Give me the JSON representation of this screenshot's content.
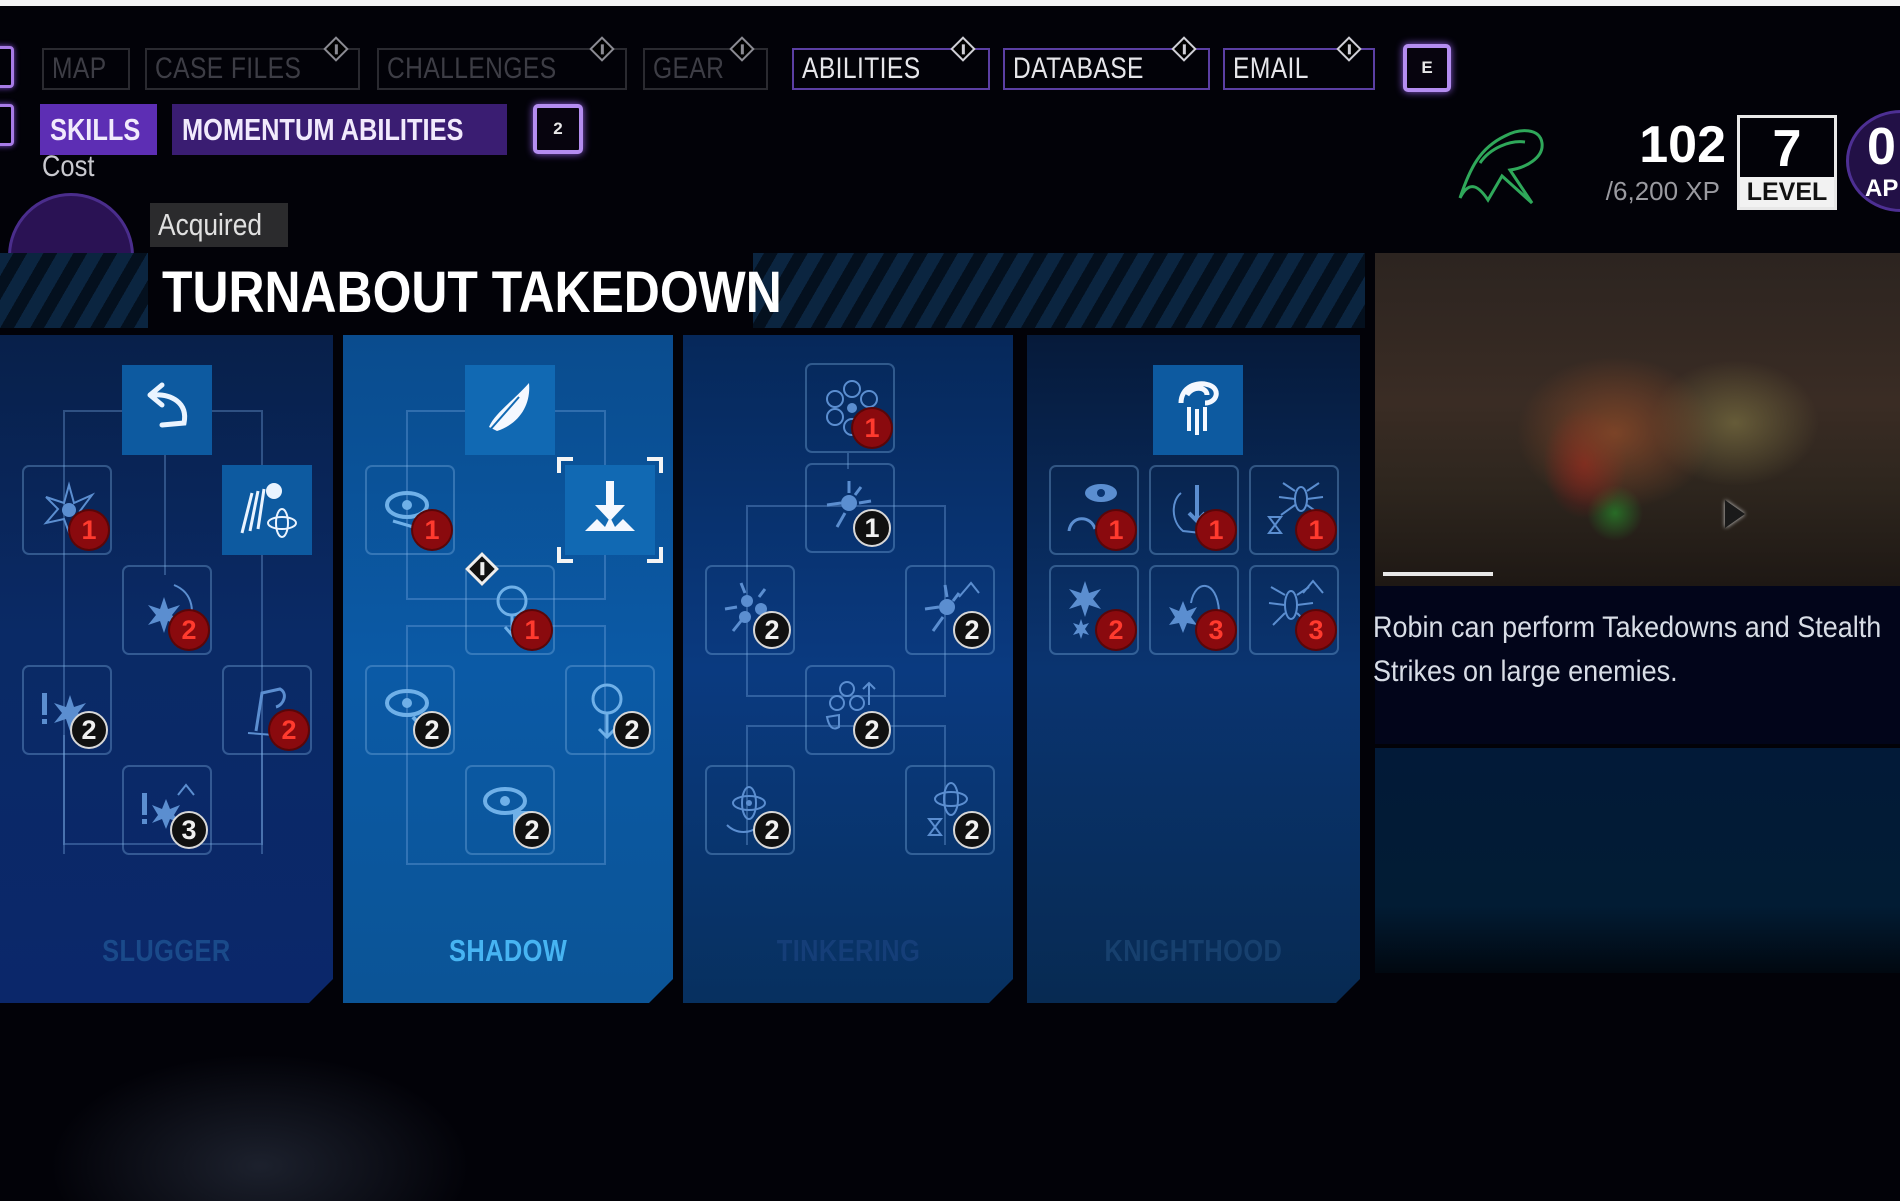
{
  "top_tabs": [
    {
      "label": "MAP",
      "active": false,
      "has_alert": false
    },
    {
      "label": "CASE FILES",
      "active": false,
      "has_alert": true
    },
    {
      "label": "CHALLENGES",
      "active": false,
      "has_alert": true
    },
    {
      "label": "GEAR",
      "active": false,
      "has_alert": true
    },
    {
      "label": "ABILITIES",
      "active": true,
      "has_alert": true
    },
    {
      "label": "DATABASE",
      "active": true,
      "has_alert": true
    },
    {
      "label": "EMAIL",
      "active": true,
      "has_alert": true
    }
  ],
  "top_next_key": "E",
  "sub_tabs": [
    {
      "label": "SKILLS",
      "active": true
    },
    {
      "label": "MOMENTUM ABILITIES",
      "active": false
    }
  ],
  "sub_next_key": "2",
  "ability": {
    "cost_label": "Cost",
    "cost_unit": "AP",
    "status": "Acquired",
    "title": "TURNABOUT TAKEDOWN",
    "description": "Robin can perform Takedowns and Stealth Strikes on large enemies.",
    "preview_icon": "video-preview"
  },
  "player": {
    "character_icon": "robin-r-logo",
    "xp_current": "102",
    "xp_total": "/6,200 XP",
    "level": "7",
    "level_label": "LEVEL",
    "ap_value": "0",
    "ap_label": "AP"
  },
  "trees": [
    {
      "name": "SLUGGER",
      "selected": false,
      "nodes": [
        {
          "icon": "curved-arrow-icon",
          "unlocked": true,
          "cost": null
        },
        {
          "icon": "impact-burst-icon",
          "unlocked": false,
          "cost": "1",
          "affordable": false
        },
        {
          "icon": "dash-atom-icon",
          "unlocked": true,
          "cost": null
        },
        {
          "icon": "burst-arc-icon",
          "unlocked": false,
          "cost": "2",
          "affordable": false
        },
        {
          "icon": "alert-burst-icon",
          "unlocked": false,
          "cost": "2",
          "affordable": true
        },
        {
          "icon": "dash-figure-icon",
          "unlocked": false,
          "cost": "2",
          "affordable": false
        },
        {
          "icon": "alert-burst-up-icon",
          "unlocked": false,
          "cost": "3",
          "affordable": true
        }
      ]
    },
    {
      "name": "SHADOW",
      "selected": true,
      "nodes": [
        {
          "icon": "feather-icon",
          "unlocked": true,
          "cost": null
        },
        {
          "icon": "eye-slash-icon",
          "unlocked": false,
          "cost": "1",
          "affordable": false
        },
        {
          "icon": "down-strike-icon",
          "unlocked": true,
          "cost": null,
          "selected": true
        },
        {
          "icon": "mask-down-icon",
          "unlocked": false,
          "cost": "1",
          "affordable": false,
          "new": true
        },
        {
          "icon": "eye-arrow-icon",
          "unlocked": false,
          "cost": "2",
          "affordable": true
        },
        {
          "icon": "mask-arrow-icon",
          "unlocked": false,
          "cost": "2",
          "affordable": true
        },
        {
          "icon": "eye-box-icon",
          "unlocked": false,
          "cost": "2",
          "affordable": true
        }
      ]
    },
    {
      "name": "TINKERING",
      "selected": false,
      "nodes": [
        {
          "icon": "gear-cluster-icon",
          "unlocked": false,
          "cost": "1",
          "affordable": false
        },
        {
          "icon": "flash-burst-icon",
          "unlocked": false,
          "cost": "1",
          "affordable": true
        },
        {
          "icon": "multi-burst-icon",
          "unlocked": false,
          "cost": "2",
          "affordable": true
        },
        {
          "icon": "burst-up-icon",
          "unlocked": false,
          "cost": "2",
          "affordable": true
        },
        {
          "icon": "atom-shield-icon",
          "unlocked": false,
          "cost": "2",
          "affordable": true
        },
        {
          "icon": "atom-swirl-icon",
          "unlocked": false,
          "cost": "2",
          "affordable": true
        },
        {
          "icon": "atom-hourglass-icon",
          "unlocked": false,
          "cost": "2",
          "affordable": true
        }
      ]
    },
    {
      "name": "KNIGHTHOOD",
      "selected": false,
      "nodes": [
        {
          "icon": "robin-emblem-icon",
          "unlocked": true,
          "cost": null
        },
        {
          "icon": "eye-helmet-icon",
          "unlocked": false,
          "cost": "1",
          "affordable": false
        },
        {
          "icon": "head-arrow-icon",
          "unlocked": false,
          "cost": "1",
          "affordable": false
        },
        {
          "icon": "spider-hourglass-icon",
          "unlocked": false,
          "cost": "1",
          "affordable": false
        },
        {
          "icon": "double-burst-icon",
          "unlocked": false,
          "cost": "2",
          "affordable": false
        },
        {
          "icon": "burst-arc-icon",
          "unlocked": false,
          "cost": "3",
          "affordable": false
        },
        {
          "icon": "spider-up-icon",
          "unlocked": false,
          "cost": "3",
          "affordable": false
        }
      ]
    }
  ],
  "colors": {
    "accent_purple": "#5d2eb4",
    "cost_red": "#8a0a0e",
    "selected_tree_label": "#47b4f2",
    "robin_green": "#2fa85a"
  }
}
